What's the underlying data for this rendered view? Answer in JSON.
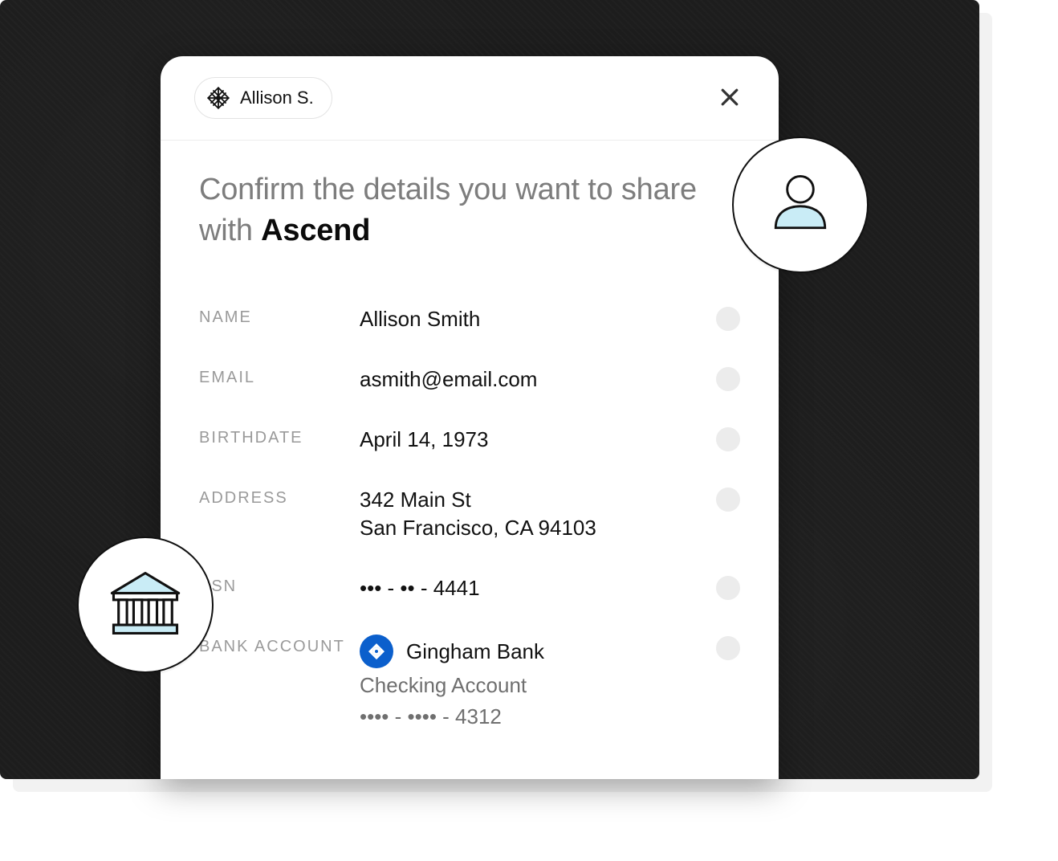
{
  "header": {
    "user_display": "Allison S."
  },
  "heading": {
    "prefix": "Confirm the details you want to share with ",
    "brand": "Ascend"
  },
  "fields": {
    "name": {
      "label": "NAME",
      "value": "Allison Smith"
    },
    "email": {
      "label": "EMAIL",
      "value": "asmith@email.com"
    },
    "birthdate": {
      "label": "BIRTHDATE",
      "value": "April 14, 1973"
    },
    "address": {
      "label": "ADDRESS",
      "line1": "342 Main St",
      "line2": "San Francisco, CA 94103"
    },
    "ssn": {
      "label": "SSN",
      "value": "••• - •• - 4441"
    },
    "bank": {
      "label": "BANK ACCOUNT",
      "bank_name": "Gingham Bank",
      "account_type": "Checking Account",
      "masked_number": "•••• - •••• - 4312"
    }
  },
  "icons": {
    "logo": "plaid-logo-icon",
    "close": "close-icon",
    "user_badge": "user-icon",
    "bank_badge": "bank-building-icon",
    "bank_item": "bank-emblem-icon"
  },
  "colors": {
    "accent_blue": "#0b5fcc",
    "ice_blue": "#c9ecf6",
    "muted_text": "#7d7d7d",
    "label_text": "#9a9a9a",
    "toggle_bg": "#ececec",
    "stage_bg": "#1d1d1d"
  }
}
